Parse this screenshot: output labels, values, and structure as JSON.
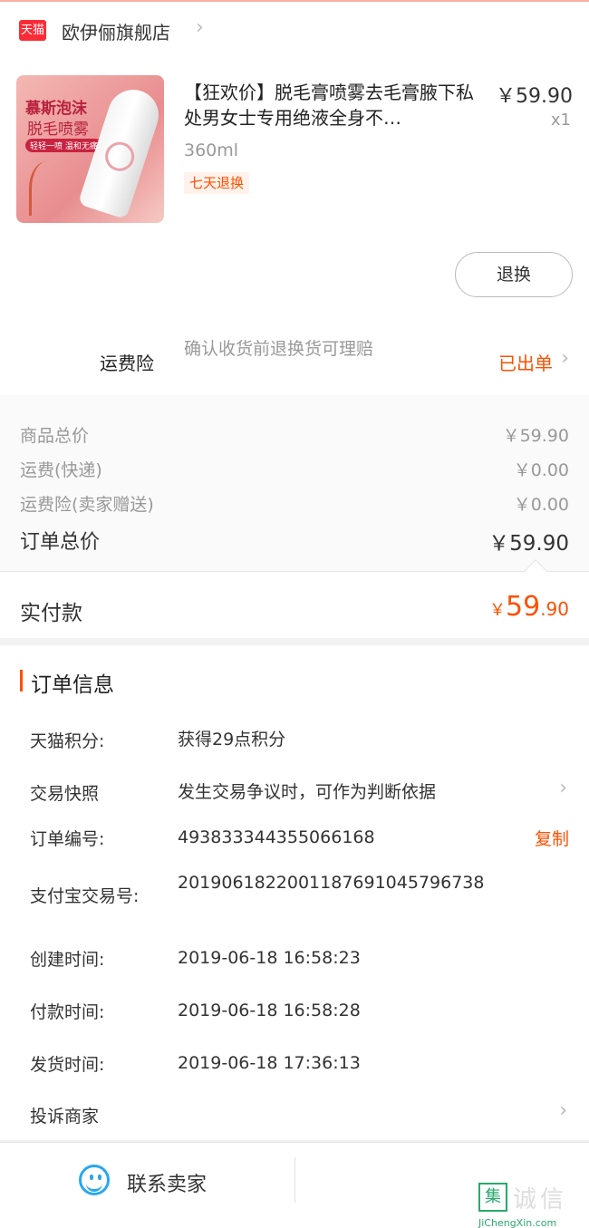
{
  "shop": {
    "badge": "天猫",
    "name": "欧伊俪旗舰店"
  },
  "product": {
    "title": "【狂欢价】脱毛膏喷雾去毛膏腋下私处男女士专用绝液全身不…",
    "price": "￥59.90",
    "qty": "x1",
    "spec": "360ml",
    "tag": "七天退换",
    "image_text_1": "慕斯泡沫",
    "image_text_2": "脱毛喷雾",
    "image_tag": "轻轻一喷 温和无痛"
  },
  "return_button": "退换",
  "insurance": {
    "label": "运费险",
    "desc": "确认收货前退换货可理赔",
    "status": "已出单"
  },
  "fees": [
    {
      "label": "商品总价",
      "value": "￥59.90"
    },
    {
      "label": "运费(快递)",
      "value": "￥0.00"
    },
    {
      "label": "运费险(卖家赠送)",
      "value": "￥0.00"
    }
  ],
  "total": {
    "label": "订单总价",
    "value": "￥59.90"
  },
  "paid": {
    "label": "实付款",
    "currency": "￥",
    "integer": "59",
    "decimal": ".90"
  },
  "order_info": {
    "title": "订单信息",
    "points": {
      "label": "天猫积分:",
      "value": "获得29点积分"
    },
    "snapshot": {
      "label": "交易快照",
      "value": "发生交易争议时，可作为判断依据"
    },
    "order_no": {
      "label": "订单编号:",
      "value": "493833344355066168",
      "action": "复制"
    },
    "alipay_no": {
      "label": "支付宝交易号:",
      "value": "2019061822001187691045796738"
    },
    "created": {
      "label": "创建时间:",
      "value": "2019-06-18 16:58:23"
    },
    "paid_time": {
      "label": "付款时间:",
      "value": "2019-06-18 16:58:28"
    },
    "shipped": {
      "label": "发货时间:",
      "value": "2019-06-18 17:36:13"
    },
    "complain": {
      "label": "投诉商家"
    }
  },
  "footer": {
    "contact": "联系卖家"
  },
  "watermark": {
    "box": "集",
    "text": "诚信",
    "sub": "JiChengXin.com"
  },
  "colors": {
    "accent": "#ff5000",
    "tmall_red": "#ff2b36",
    "contact_blue": "#29a7ef"
  }
}
